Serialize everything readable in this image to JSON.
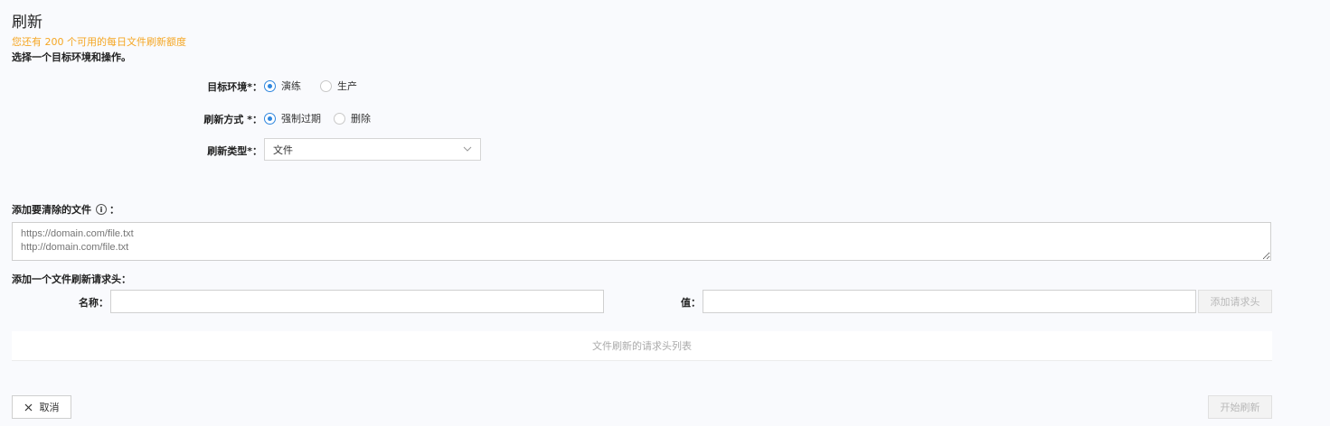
{
  "page": {
    "title": "刷新",
    "quota_notice": "您还有 200 个可用的每日文件刷新额度",
    "intro": "选择一个目标环境和操作。"
  },
  "form": {
    "environment": {
      "label": "目标环境*：",
      "options": [
        {
          "label": "演练",
          "checked": true
        },
        {
          "label": "生产",
          "checked": false
        }
      ]
    },
    "method": {
      "label": "刷新方式 *：",
      "options": [
        {
          "label": "强制过期",
          "checked": true
        },
        {
          "label": "删除",
          "checked": false
        }
      ]
    },
    "type": {
      "label": "刷新类型*：",
      "selected": "文件"
    }
  },
  "files": {
    "label": "添加要清除的文件",
    "info_icon": "info-icon",
    "suffix": "：",
    "placeholder": "https://domain.com/file.txt\nhttp://domain.com/file.txt"
  },
  "headers": {
    "label": "添加一个文件刷新请求头：",
    "name_label": "名称：",
    "value_label": "值：",
    "add_button": "添加请求头",
    "empty_list": "文件刷新的请求头列表"
  },
  "footer": {
    "cancel_button": "取消",
    "start_button": "开始刷新"
  },
  "colors": {
    "accent": "#2e86de",
    "quota": "#f5a623",
    "background": "#f9fafd"
  }
}
